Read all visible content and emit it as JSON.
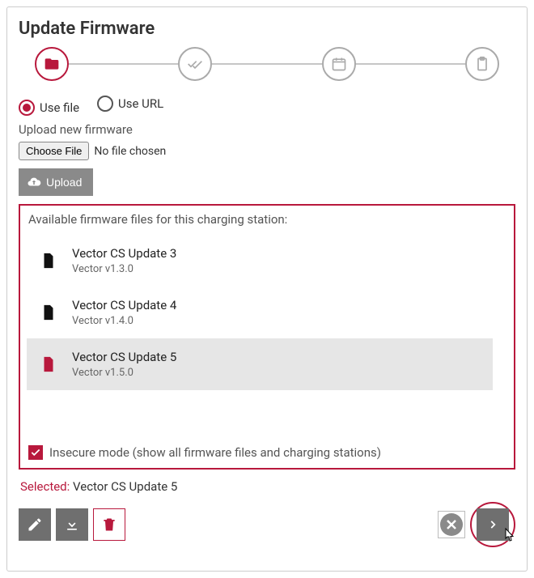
{
  "title": "Update Firmware",
  "source": {
    "useFile": "Use file",
    "useURL": "Use URL"
  },
  "uploadLabel": "Upload new firmware",
  "chooseFile": "Choose File",
  "noFileChosen": "No file chosen",
  "uploadButton": "Upload",
  "firmwareHeading": "Available firmware files for this charging station:",
  "firmwareFiles": [
    {
      "name": "Vector CS Update 3",
      "version": "Vector v1.3.0",
      "selected": false
    },
    {
      "name": "Vector CS Update 4",
      "version": "Vector v1.4.0",
      "selected": false
    },
    {
      "name": "Vector CS Update 5",
      "version": "Vector v1.5.0",
      "selected": true
    }
  ],
  "insecureMode": "Insecure mode (show all firmware files and charging stations)",
  "selectedLabel": "Selected:",
  "selectedValue": "Vector CS Update 5",
  "colors": {
    "accent": "#b8183c",
    "grayBtn": "#6f6f6f"
  }
}
